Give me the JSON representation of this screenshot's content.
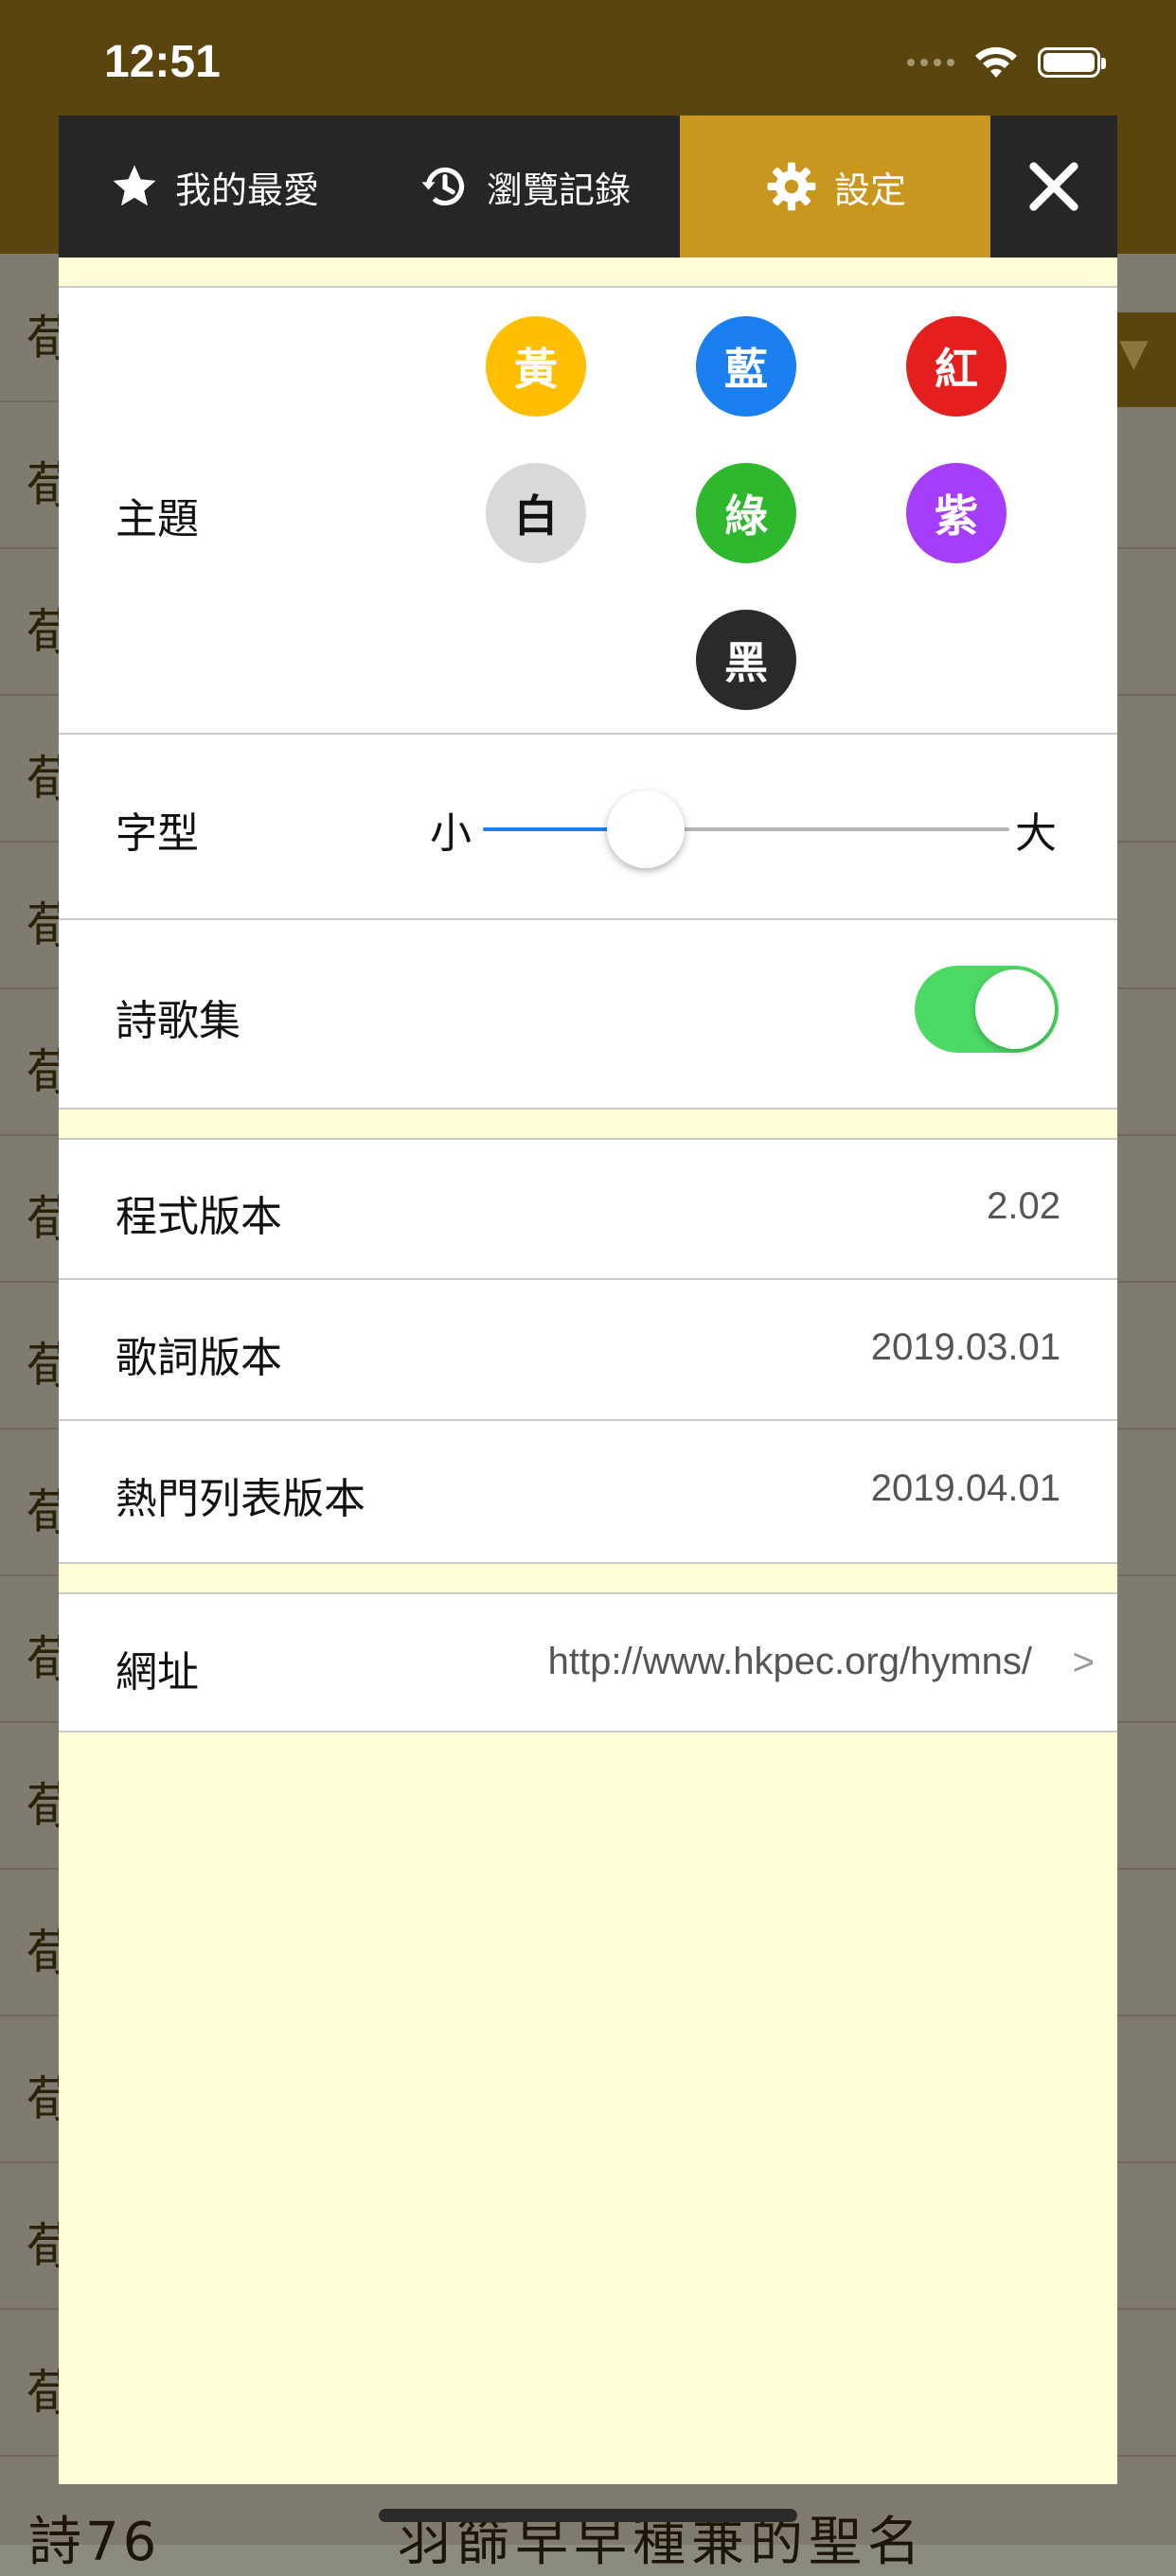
{
  "status_bar": {
    "time": "12:51"
  },
  "background": {
    "row_char": "荀",
    "dropdown_arrow": "▼",
    "bottom_text_left": "詩76",
    "bottom_text_right": "羽篩早早種兼的聖名"
  },
  "tabs": [
    {
      "label": "我的最愛",
      "icon": "star-icon"
    },
    {
      "label": "瀏覽記錄",
      "icon": "history-icon"
    },
    {
      "label": "設定",
      "icon": "gear-icon",
      "selected": true
    },
    {
      "label": "",
      "icon": "close-icon"
    }
  ],
  "settings": {
    "theme": {
      "label": "主題",
      "options": [
        {
          "label": "黃",
          "color": "#ffbf00",
          "text_color": "#ffffff"
        },
        {
          "label": "藍",
          "color": "#1a7ff0",
          "text_color": "#ffffff"
        },
        {
          "label": "紅",
          "color": "#e51e1e",
          "text_color": "#ffffff"
        },
        {
          "label": "白",
          "color": "#d9d9d9",
          "text_color": "#111111"
        },
        {
          "label": "綠",
          "color": "#2eb82e",
          "text_color": "#ffffff"
        },
        {
          "label": "紫",
          "color": "#a63dfa",
          "text_color": "#ffffff"
        },
        {
          "label": "黑",
          "color": "#2a2a2a",
          "text_color": "#ffffff"
        }
      ]
    },
    "font": {
      "label": "字型",
      "min_label": "小",
      "max_label": "大",
      "value": 0.31
    },
    "hymnal": {
      "label": "詩歌集",
      "enabled": true
    },
    "app_version": {
      "label": "程式版本",
      "value": "2.02"
    },
    "lyrics_version": {
      "label": "歌詞版本",
      "value": "2019.03.01"
    },
    "popular_list_version": {
      "label": "熱門列表版本",
      "value": "2019.04.01"
    },
    "website": {
      "label": "網址",
      "value": "http://www.hkpec.org/hymns/",
      "chevron": ">"
    }
  },
  "colors": {
    "accent": "#c9961e",
    "panel_bg": "#fffed6",
    "tabbar_bg": "#262626",
    "toggle_on": "#4cd964",
    "slider_fill": "#1a7ff0"
  }
}
